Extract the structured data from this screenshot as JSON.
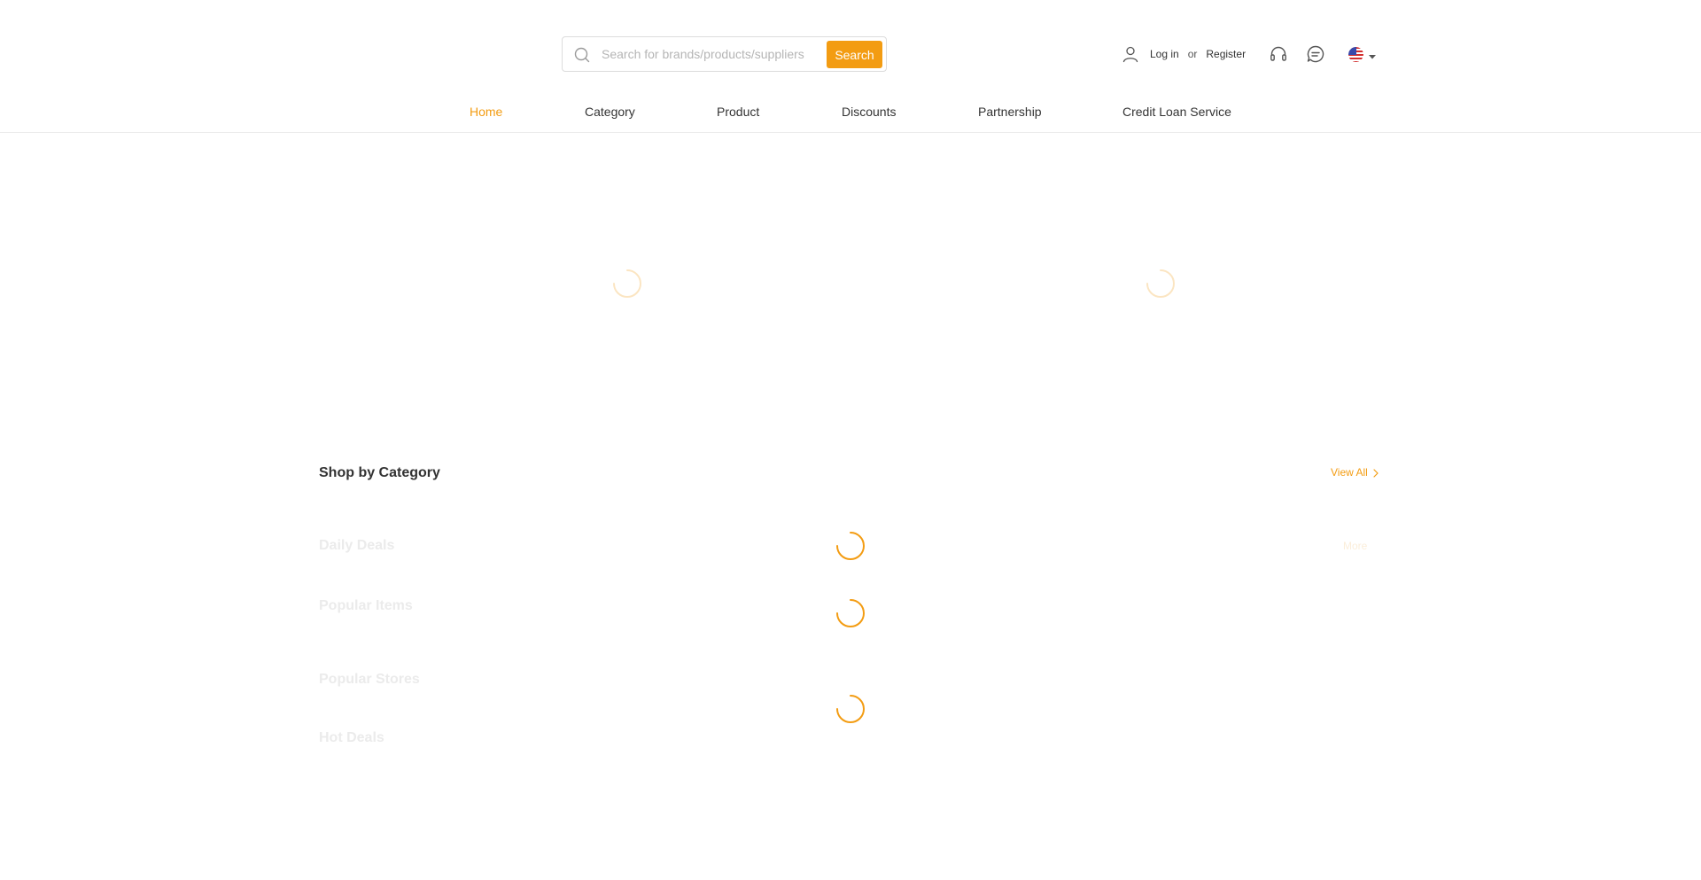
{
  "search": {
    "placeholder": "Search for brands/products/suppliers",
    "value": "",
    "button_label": "Search",
    "icon": "search-icon"
  },
  "account": {
    "icon": "user-icon",
    "login_label": "Log in",
    "or_label": "or",
    "register_label": "Register"
  },
  "header_icons": {
    "support": "headset-icon",
    "messages": "chat-icon",
    "language": "us-flag-icon",
    "dropdown": "caret-down-icon"
  },
  "nav": {
    "active": "Home",
    "items": [
      {
        "label": "Home"
      },
      {
        "label": "Category"
      },
      {
        "label": "Product"
      },
      {
        "label": "Discounts"
      },
      {
        "label": "Partnership"
      },
      {
        "label": "Credit Loan Service"
      }
    ]
  },
  "sections": {
    "shop_by_category": {
      "title": "Shop by Category",
      "view_all_label": "View All"
    },
    "daily_deals": {
      "title": "Daily Deals",
      "more_label": "More"
    },
    "popular_items": {
      "title": "Popular Items"
    },
    "popular_stores": {
      "title": "Popular Stores"
    },
    "hot_deals": {
      "title": "Hot Deals"
    }
  },
  "colors": {
    "accent": "#f39c12",
    "text": "#333333",
    "border": "#ececec",
    "faint_text": "#ebebeb"
  }
}
